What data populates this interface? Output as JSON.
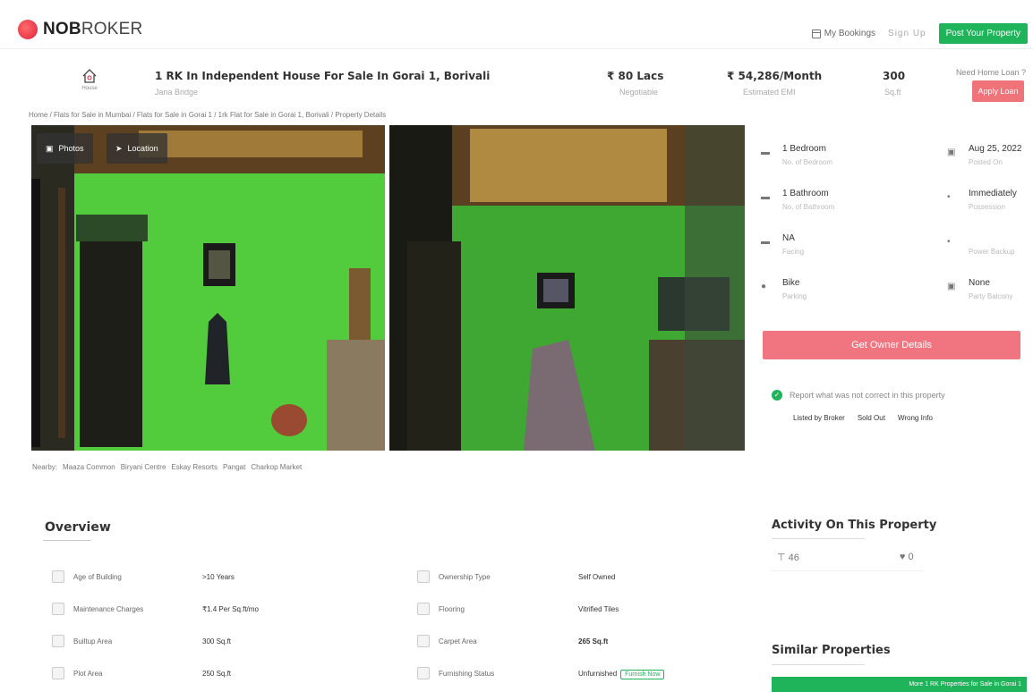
{
  "header": {
    "logo_bold": "NOB",
    "logo_rest": "ROKER",
    "my_bookings": "My Bookings",
    "sign_up": "Sign Up",
    "post_property": "Post Your Property"
  },
  "property": {
    "house_label": "House",
    "title": "1 RK In Independent House For Sale In Gorai 1, Borivali",
    "subtitle": "Jana Bridge",
    "price": "₹ 80 Lacs",
    "price_sub": "Negotiable",
    "emi": "₹ 54,286/Month",
    "emi_sub": "Estimated EMI",
    "area": "300",
    "area_sub": "Sq.ft",
    "loan_question": "Need Home Loan ?",
    "apply_loan": "Apply Loan"
  },
  "breadcrumb": "Home / Flats for Sale in Mumbai / Flats for Sale in Gorai 1 / 1rk Flat for Sale in Gorai 1, Borivali / Property Details",
  "gallery": {
    "photos_btn": "Photos",
    "location_btn": "Location"
  },
  "details": [
    {
      "value": "1 Bedroom",
      "sub": "No. of Bedroom",
      "icon": "bed-icon"
    },
    {
      "value": "Aug 25, 2022",
      "sub": "Posted On",
      "icon": "calendar-icon"
    },
    {
      "value": "1 Bathroom",
      "sub": "No. of Bathroom",
      "icon": "bath-icon"
    },
    {
      "value": "Immediately",
      "sub": "Possession",
      "icon": "key-icon"
    },
    {
      "value": "NA",
      "sub": "Facing",
      "icon": "compass-icon"
    },
    {
      "value": "",
      "sub": "Power Backup",
      "icon": "power-icon"
    },
    {
      "value": "Bike",
      "sub": "Parking",
      "icon": "parking-icon"
    },
    {
      "value": "None",
      "sub": "Party Balcony",
      "icon": "balcony-icon"
    }
  ],
  "get_owner_details": "Get Owner Details",
  "report": {
    "text": "Report what was not correct in this property",
    "options": [
      "Listed by Broker",
      "Sold Out",
      "Wrong Info"
    ]
  },
  "nearby": {
    "label": "Nearby:",
    "places": [
      "Maaza Common",
      "Biryani Centre",
      "Eskay Resorts",
      "Pangat",
      "Charkop Market"
    ]
  },
  "overview": {
    "title": "Overview",
    "rows": [
      {
        "key": "Age of Building",
        "value": ">10 Years",
        "key2": "Ownership Type",
        "value2": "Self Owned"
      },
      {
        "key": "Maintenance Charges",
        "value": "₹1.4 Per Sq.ft/mo",
        "key2": "Flooring",
        "value2": "Vitrified Tiles"
      },
      {
        "key": "Builtup Area",
        "value": "300 Sq.ft",
        "key2": "Carpet Area",
        "value2": "265 Sq.ft"
      },
      {
        "key": "Plot Area",
        "value": "250 Sq.ft",
        "key2": "Furnishing Status",
        "value2": "Unfurnished",
        "badge": "Furnish Now"
      }
    ]
  },
  "activity": {
    "title": "Activity On This Property",
    "views": "46",
    "likes": "0"
  },
  "similar": {
    "title": "Similar Properties",
    "more": "More 1 RK Properties for Sale in Gorai 1"
  }
}
